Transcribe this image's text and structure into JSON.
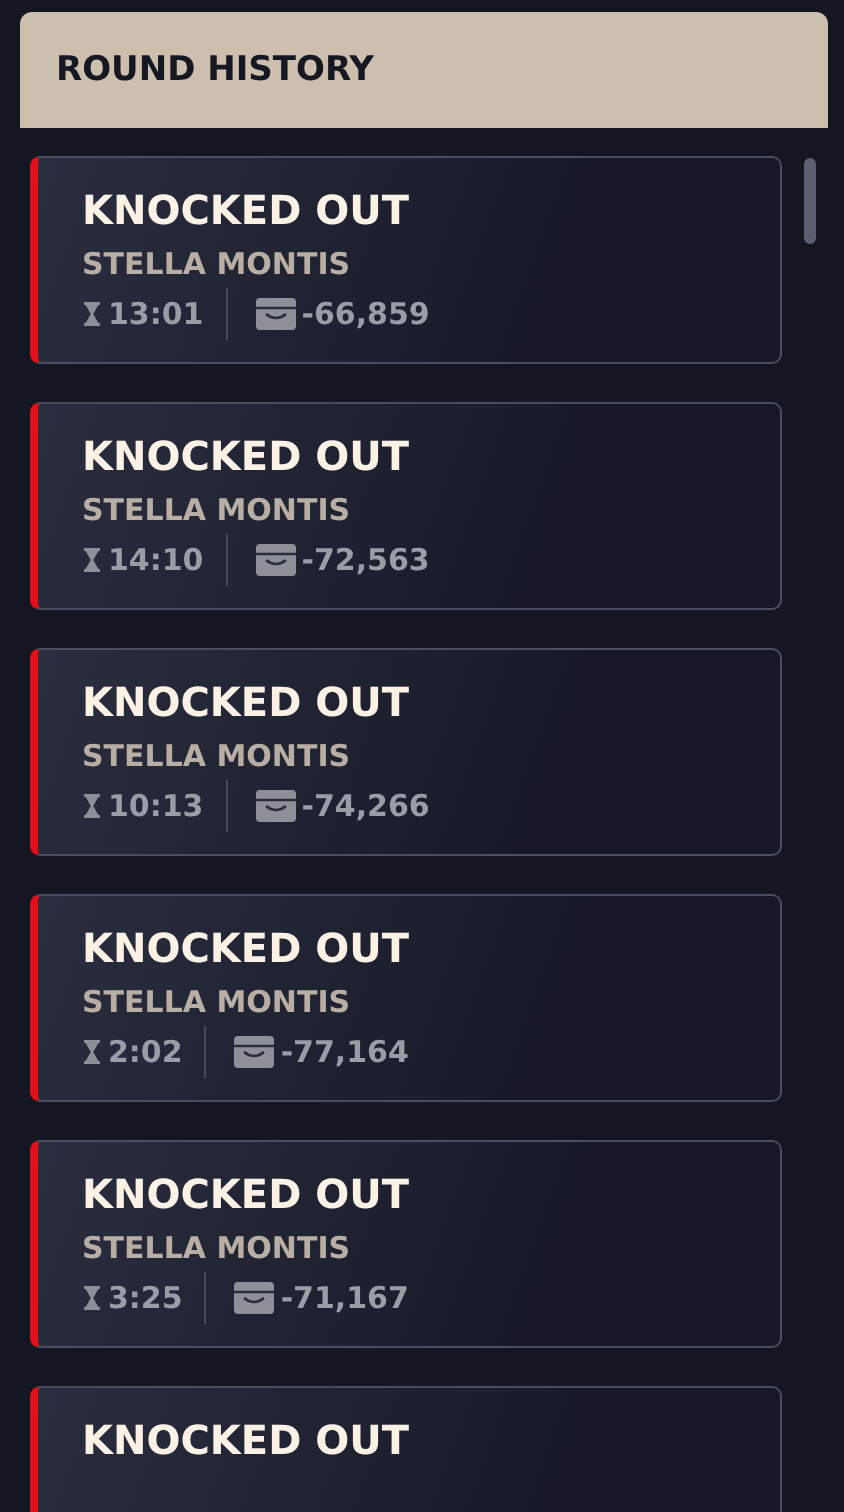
{
  "header": {
    "title": "ROUND HISTORY"
  },
  "rounds": [
    {
      "result": "KNOCKED OUT",
      "map": "STELLA MONTIS",
      "time": "13:01",
      "amount": "-66,859"
    },
    {
      "result": "KNOCKED OUT",
      "map": "STELLA MONTIS",
      "time": "14:10",
      "amount": "-72,563"
    },
    {
      "result": "KNOCKED OUT",
      "map": "STELLA MONTIS",
      "time": "10:13",
      "amount": "-74,266"
    },
    {
      "result": "KNOCKED OUT",
      "map": "STELLA MONTIS",
      "time": "2:02",
      "amount": "-77,164"
    },
    {
      "result": "KNOCKED OUT",
      "map": "STELLA MONTIS",
      "time": "3:25",
      "amount": "-71,167"
    },
    {
      "result": "KNOCKED OUT"
    }
  ]
}
